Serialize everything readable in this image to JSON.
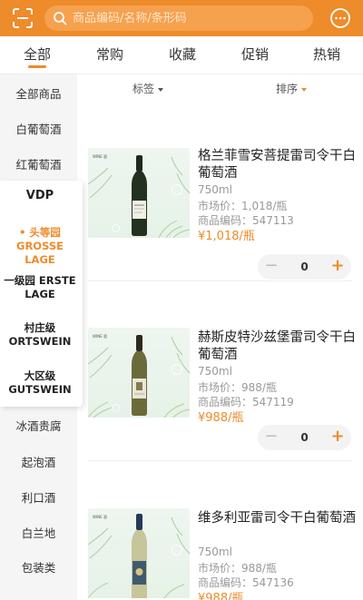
{
  "search": {
    "placeholder": "商品编码/名称/条形码"
  },
  "tabs": [
    {
      "label": "全部",
      "active": true
    },
    {
      "label": "常购"
    },
    {
      "label": "收藏"
    },
    {
      "label": "促销"
    },
    {
      "label": "热销"
    }
  ],
  "sidebar": {
    "items": [
      "全部商品",
      "白葡萄酒",
      "红葡萄酒",
      "冰酒贵腐",
      "起泡酒",
      "利口酒",
      "白兰地",
      "包装类"
    ],
    "submenu": {
      "title": "VDP",
      "items": [
        {
          "label": "• 头等园 GROSSE LAGE",
          "active": true
        },
        {
          "label": "一级园 ERSTE LAGE"
        },
        {
          "label": "村庄级 ORTSWEIN"
        },
        {
          "label": "大区级 GUTSWEIN"
        }
      ]
    }
  },
  "filters": {
    "tag": "标签",
    "sort": "排序"
  },
  "products": [
    {
      "name": "格兰菲雪安菩提雷司令干白葡萄酒",
      "volume": "750ml",
      "market_price": "市场价：1,018/瓶",
      "code": "商品编码：547113",
      "price": "¥1,018/瓶",
      "qty": "0"
    },
    {
      "name": "赫斯皮特沙兹堡雷司令干白葡萄酒",
      "volume": "750ml",
      "market_price": "市场价：988/瓶",
      "code": "商品编码：547119",
      "price": "¥988/瓶",
      "qty": "0"
    },
    {
      "name": "维多利亚雷司令干白葡萄酒",
      "volume": "750ml",
      "market_price": "市场价：988/瓶",
      "code": "商品编码：547136",
      "price": "¥988/瓶"
    }
  ],
  "icons": {
    "scan": "scan-icon",
    "search": "search-icon",
    "message": "message-icon",
    "minus": "minus-icon",
    "plus": "plus-icon"
  },
  "colors": {
    "accent": "#ee8b2a",
    "search_bg": "#f6a14e"
  }
}
